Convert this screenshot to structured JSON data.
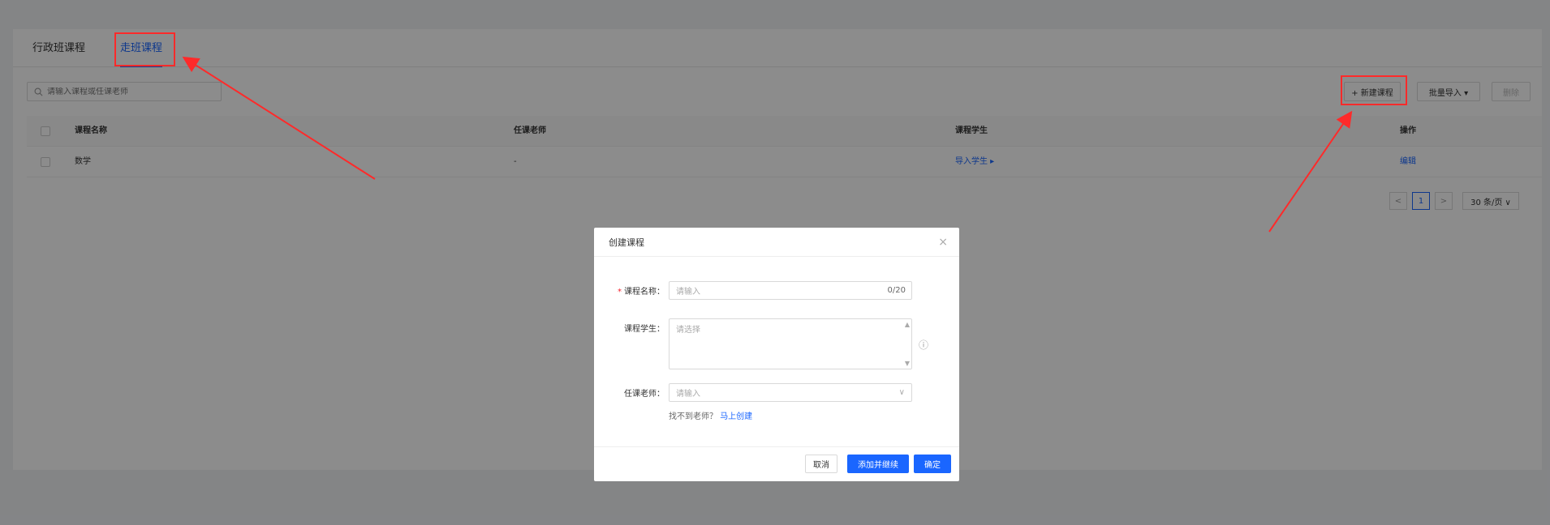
{
  "tabs": [
    {
      "label": "行政班课程"
    },
    {
      "label": "走班课程"
    }
  ],
  "search": {
    "placeholder": "请输入课程或任课老师"
  },
  "toolbar": {
    "new_label": "+ 新建课程",
    "import_label": "批量导入 ▾",
    "delete_label": "删除"
  },
  "table": {
    "headers": [
      "课程名称",
      "任课老师",
      "课程学生",
      "操作"
    ],
    "rows": [
      {
        "name": "数学",
        "teacher": "-",
        "students": "导入学生 ▸",
        "action": "编辑"
      }
    ]
  },
  "pagination": {
    "prev": "<",
    "page": "1",
    "next": ">",
    "size": "30 条/页 ∨"
  },
  "modal": {
    "title": "创建课程",
    "close": "×",
    "name_label": "课程名称：",
    "name_required": "*",
    "name_placeholder": "请输入",
    "name_count": "0/20",
    "students_label": "课程学生：",
    "students_placeholder": "请选择",
    "teacher_label": "任课老师：",
    "teacher_placeholder": "请输入",
    "hint_text": "找不到老师？",
    "hint_link": "马上创建",
    "cancel": "取消",
    "add_continue": "添加并继续",
    "confirm": "确定"
  },
  "colors": {
    "accent": "#1a66ff",
    "annotation": "#ff2a2a"
  }
}
